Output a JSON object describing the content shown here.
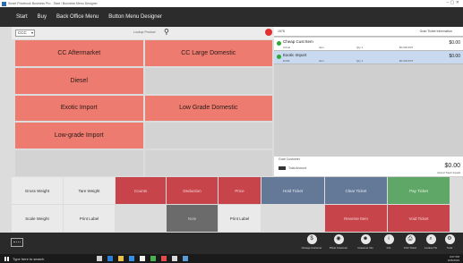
{
  "window": {
    "title": "Smart Pricebook Business Pro - Start / Business Menu Designer",
    "controls": "–  ▢  ✕"
  },
  "menu": {
    "items": [
      "Start",
      "Buy",
      "Back Office Menu",
      "Button Menu Designer"
    ]
  },
  "left": {
    "dropdown_value": "CCC",
    "search_label": "Lookup Product",
    "products": [
      {
        "label": "CC Aftermarket"
      },
      {
        "label": "CC Large Domestic"
      },
      {
        "label": "Diesel"
      },
      {
        "label": ""
      },
      {
        "label": "Exotic Import"
      },
      {
        "label": "Low Grade Domestic"
      },
      {
        "label": "Low-grade Import"
      },
      {
        "label": ""
      },
      {
        "label": ""
      },
      {
        "label": ""
      }
    ]
  },
  "order": {
    "number": "1578",
    "header_right": "Grab Ticket Information",
    "lines": [
      {
        "name": "Cheap Cust Item",
        "sub1": "CCLE",
        "sub2": "Item",
        "sub3": "Qty 1",
        "sub4": "$0.00/UNIT",
        "price": "$0.00"
      },
      {
        "name": "Exotic Import",
        "sub1": "EXIM",
        "sub2": "Item",
        "sub3": "Qty 1",
        "sub4": "$0.00/UNIT",
        "price": "$0.00"
      }
    ],
    "customer_label": "Grab Customer",
    "total_label": "Total Amount",
    "total": "$0.00",
    "discount_label": "Grand Total Unpaid"
  },
  "functions": {
    "row1": [
      "Gross Weight",
      "Tare Weight",
      "Counts",
      "Deduction",
      "Price",
      "Hold Ticket",
      "Clear Ticket",
      "Pay Ticket"
    ],
    "row2": [
      "Scale Weight",
      "Print Label",
      "",
      "Note",
      "Print Label",
      "",
      "Reverse Item",
      "Void Ticket"
    ]
  },
  "dock": {
    "items": [
      {
        "icon": "payment-icon",
        "glyph": "$",
        "label": "Change Customer"
      },
      {
        "icon": "camera-icon",
        "glyph": "◉",
        "label": "Photo Customer"
      },
      {
        "icon": "customer-icon",
        "glyph": "☻",
        "label": "Customer Info"
      },
      {
        "icon": "info-icon",
        "glyph": "i",
        "label": "Info"
      },
      {
        "icon": "print-icon",
        "glyph": "⎙",
        "label": "Print Ticket"
      },
      {
        "icon": "search-icon",
        "glyph": "⌕",
        "label": "Lookup Tkt"
      },
      {
        "icon": "tools-icon",
        "glyph": "⚙",
        "label": "Tools"
      }
    ]
  },
  "taskbar": {
    "search_text": "Type here to search",
    "time": "4:07 PM",
    "date": "10/5/2019"
  },
  "colors": {
    "product_red": "#ee7b6f",
    "fn_red": "#c8444b",
    "fn_slate": "#647998",
    "fn_green": "#5fa766",
    "selected_line": "#c9daf0"
  }
}
